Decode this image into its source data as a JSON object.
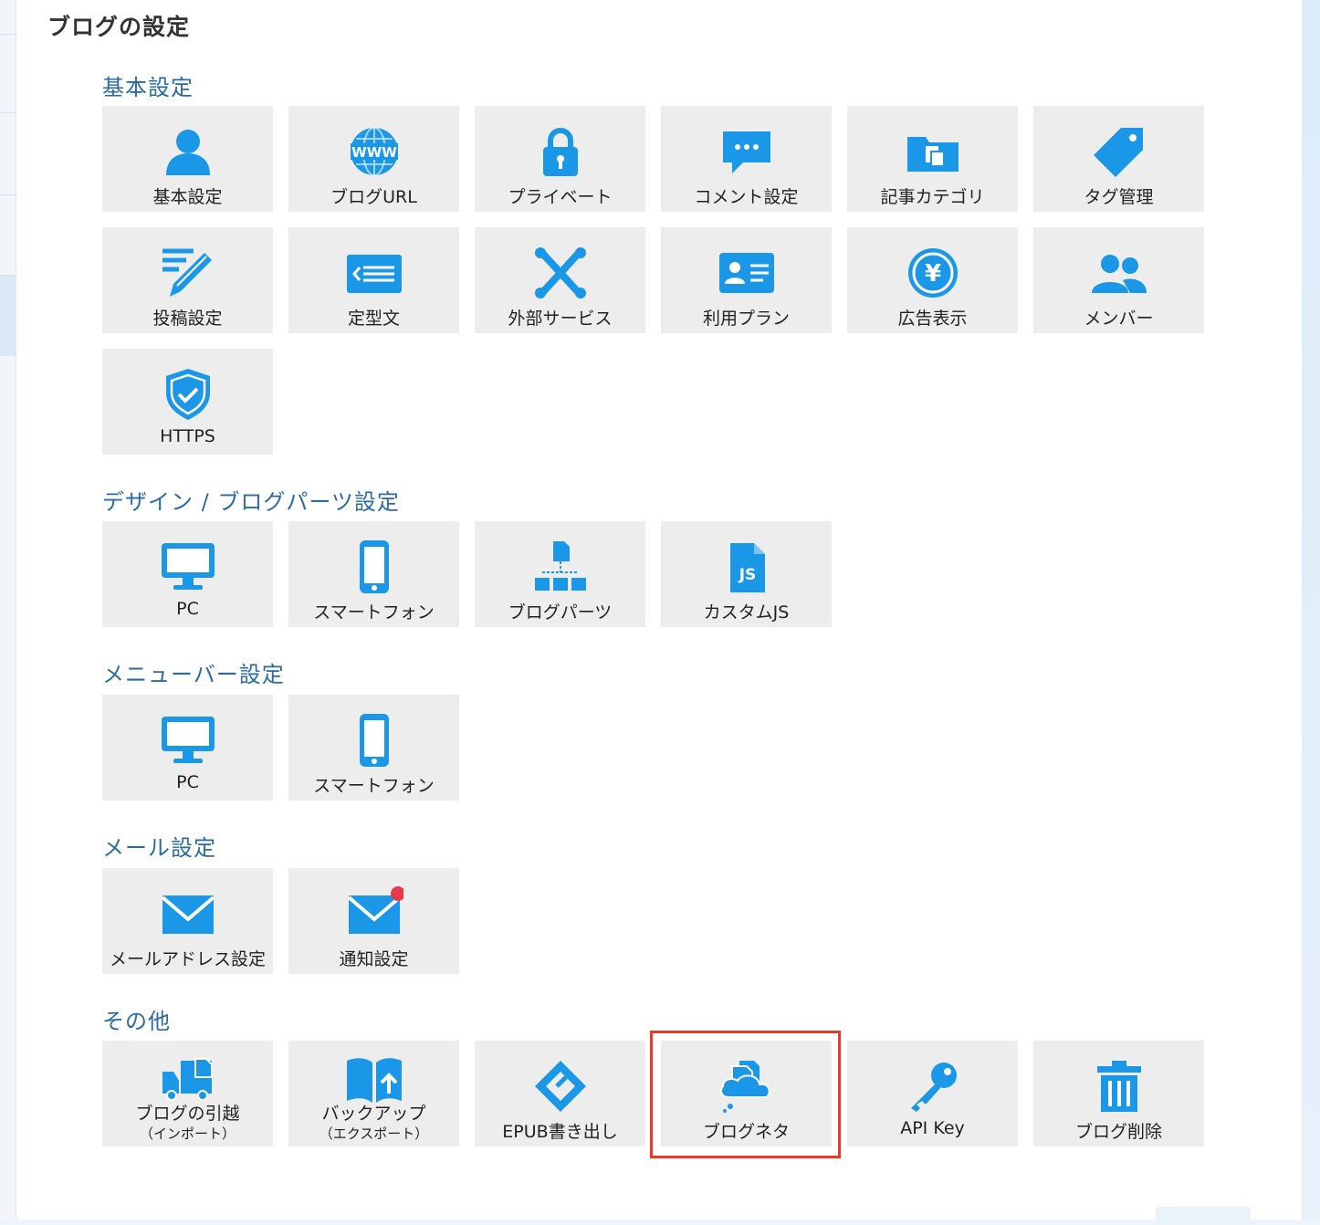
{
  "page_title": "ブログの設定",
  "accent_color": "#1a97e6",
  "highlight_color": "#e8392a",
  "sections": {
    "basic": {
      "title": "基本設定",
      "items": [
        "基本設定",
        "ブログURL",
        "プライベート",
        "コメント設定",
        "記事カテゴリ",
        "タグ管理",
        "投稿設定",
        "定型文",
        "外部サービス",
        "利用プラン",
        "広告表示",
        "メンバー",
        "HTTPS"
      ]
    },
    "design": {
      "title": "デザイン / ブログパーツ設定",
      "items": [
        "PC",
        "スマートフォン",
        "ブログパーツ",
        "カスタムJS"
      ]
    },
    "menubar": {
      "title": "メニューバー設定",
      "items": [
        "PC",
        "スマートフォン"
      ]
    },
    "mail": {
      "title": "メール設定",
      "items": [
        "メールアドレス設定",
        "通知設定"
      ]
    },
    "other": {
      "title": "その他",
      "items": [
        {
          "label": "ブログの引越",
          "sub": "（インポート）"
        },
        {
          "label": "バックアップ",
          "sub": "（エクスポート）"
        },
        {
          "label": "EPUB書き出し"
        },
        {
          "label": "ブログネタ"
        },
        {
          "label": "API Key"
        },
        {
          "label": "ブログ削除"
        }
      ]
    }
  },
  "icons": {
    "basic": [
      "user-icon",
      "www-globe-icon",
      "lock-icon",
      "speech-bubble-icon",
      "folder-icon",
      "tag-icon",
      "pencil-icon",
      "template-icon",
      "cross-tools-icon",
      "id-card-icon",
      "yen-coin-icon",
      "members-icon",
      "shield-check-icon"
    ],
    "design": [
      "monitor-icon",
      "smartphone-icon",
      "blog-parts-icon",
      "js-file-icon"
    ],
    "menubar": [
      "monitor-icon",
      "smartphone-icon"
    ],
    "mail": [
      "envelope-icon",
      "envelope-notification-icon"
    ],
    "other": [
      "moving-truck-icon",
      "backup-book-icon",
      "epub-icon",
      "blog-neta-icon",
      "key-icon",
      "trash-icon"
    ]
  }
}
